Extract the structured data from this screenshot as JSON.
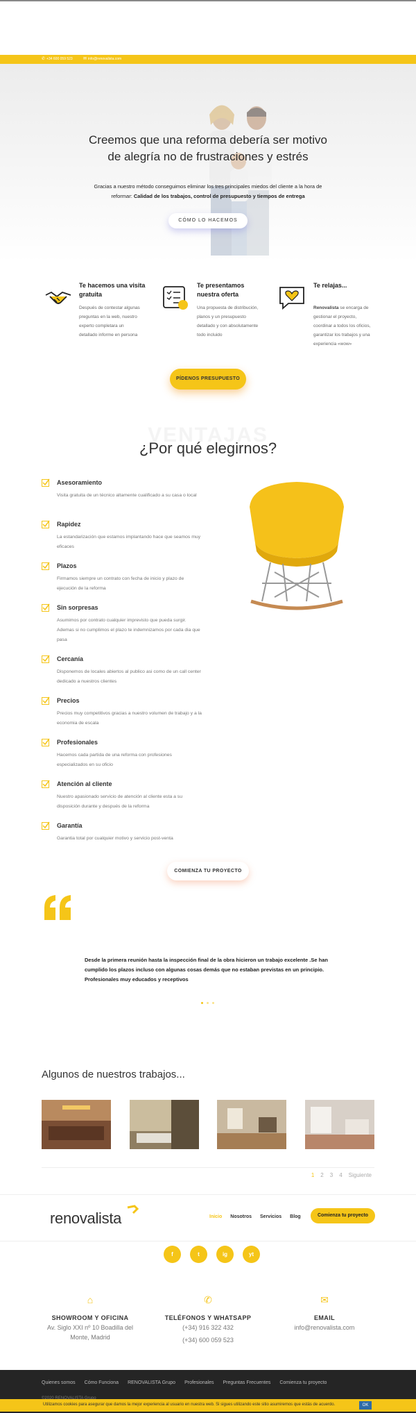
{
  "topbar": {
    "phone": "+34 600 059 523",
    "email": "info@renovalista.com"
  },
  "hero": {
    "title": "Creemos que una reforma debería ser motivo de alegría no de frustraciones y estrés",
    "subtitle_part1": "Gracias a nuestro método conseguimos eliminar los tres principales miedos del cliente a la hora de reformar:",
    "subtitle_bold": "Calidad de los trabajos, control de presupuesto y tiempos de entrega",
    "button": "CÓMO LO HACEMOS"
  },
  "steps": [
    {
      "title": "Te hacemos una visita gratuita",
      "icon": "handshake-icon",
      "text": "Después de contestar algunas preguntas en la web, nuestro experto completara un detallado informe en persona"
    },
    {
      "title": "Te presentamos nuestra oferta",
      "icon": "checklist-icon",
      "text": "Una propuesta de distribución, planos y un presupuesto detallado y con absolutamente todo incluido"
    },
    {
      "title": "Te relajas...",
      "icon": "heart-chat-icon",
      "text_bold": "Renovalista",
      "text": "se encarga de gestionar el proyecto, coordinar a todos los oficios, garantizar los trabajos y una experiencia «wow»"
    }
  ],
  "cta_budget": "PÍDENOS PRESUPUESTO",
  "why": {
    "ghost_word": "VENTAJAS",
    "title": "¿Por qué elegirnos?",
    "features": [
      {
        "title": "Asesoramiento",
        "text": "Visita gratuita de un técnico altamente cualificado a su casa o local"
      },
      {
        "title": "Rapidez",
        "text": "La estandarización que estamos implantando hace que seamos muy eficaces"
      },
      {
        "title": "Plazos",
        "text": "Firmamos siempre un contrato con fecha de inicio y plazo de ejecución de la reforma"
      },
      {
        "title": "Sin sorpresas",
        "text": "Asumimos por contrato cualquier imprevisto que pueda surgir. Ademas si no cumplimos el plazo te indemnizamos por cada dia que pasa"
      },
      {
        "title": "Cercanía",
        "text": "Disponemos de locales abiertos al publico asi como de un call center dedicado a nuestros clientes"
      },
      {
        "title": "Precios",
        "text": "Precios muy competitivos gracias a nuestro volumen de trabajo y a la economia de escala"
      },
      {
        "title": "Profesionales",
        "text": "Hacemos cada partida de una reforma con profesiones especializados en su oficio"
      },
      {
        "title": "Atención al cliente",
        "text": "Nuestro apasionado servicio de atención al cliente esta a su disposición durante y después de la reforma"
      },
      {
        "title": "Garantía",
        "text": "Garantia total por cualquier motivo y servicio post-venta"
      }
    ]
  },
  "cta_start": "COMIENZA TU PROYECTO",
  "testimonial": "Desde la primera reunión hasta la inspección final de la obra hicieron un trabajo excelente .Se han cumplido los plazos incluso con algunas cosas demás que no estaban previstas en un principio. Profesionales muy educados y receptivos",
  "works": {
    "title": "Algunos de nuestros trabajos...",
    "pages": [
      "1",
      "2",
      "3",
      "4"
    ],
    "next": "Siguiente"
  },
  "nav": {
    "logo": "renovalista",
    "items": [
      "Inicio",
      "Nosotros",
      "Servicios",
      "Blog"
    ],
    "cta": "Comienza tu proyecto"
  },
  "socials": [
    "f",
    "t",
    "ig",
    "yt"
  ],
  "contact": [
    {
      "title": "SHOWROOM Y OFICINA",
      "text": "Av. Siglo XXI nº 10 Boadilla del Monte, Madrid",
      "icon": "home-icon"
    },
    {
      "title": "TELÉFONOS Y WHATSAPP",
      "text": "(+34) 916 322 432",
      "text2": "(+34) 600 059 523",
      "icon": "phone-icon"
    },
    {
      "title": "EMAIL",
      "text": "info@renovalista.com",
      "icon": "mail-icon"
    }
  ],
  "footer": {
    "links": [
      "Quienes somos",
      "Cómo Funciona",
      "RENOVALISTA Grupo",
      "Profesionales",
      "Preguntas Frecuentes",
      "Comienza tu proyecto"
    ],
    "copyright": "©2020 RENOVALISTA Grupo"
  },
  "cookie": {
    "text": "Utilizamos cookies para asegurar que damos la mejor experiencia al usuario en nuestra web. Si sigues utilizando este sitio asumiremos que estás de acuerdo.",
    "ok": "OK"
  },
  "colors": {
    "accent": "#f5c518",
    "dark": "#252525"
  }
}
